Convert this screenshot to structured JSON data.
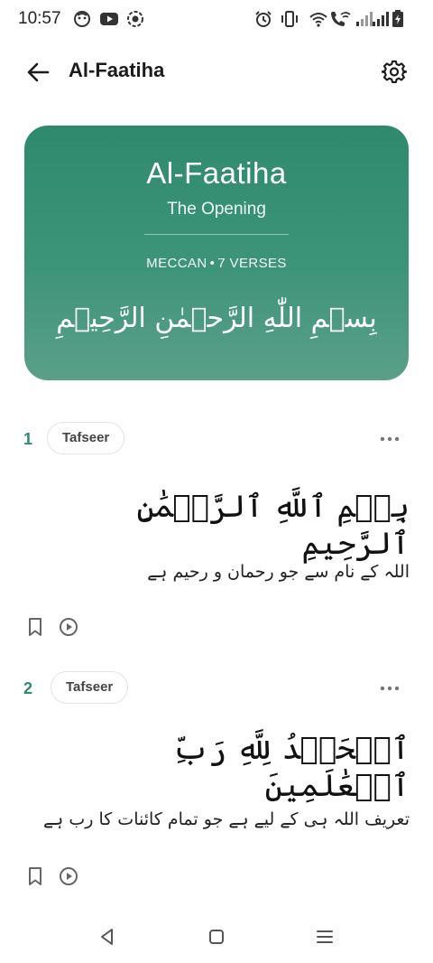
{
  "status_bar": {
    "time": "10:57",
    "icons": [
      "face-icon",
      "youtube-icon",
      "record-icon",
      "alarm-icon",
      "vibrate-icon",
      "wifi-icon",
      "wifi-calling-icon",
      "signal-icon",
      "signal-icon",
      "battery-charging-icon"
    ]
  },
  "app_bar": {
    "title": "Al-Faatiha",
    "back_icon": "arrow-left-icon",
    "settings_icon": "gear-icon"
  },
  "surah_card": {
    "title": "Al-Faatiha",
    "subtitle": "The Opening",
    "revelation": "MECCAN",
    "separator": "•",
    "verses_label": "7 VERSES",
    "bismillah": "بِسۡمِ اللّٰهِ الرَّحۡمٰنِ الرَّحِیۡمِ",
    "gradient_top": "#2f8a6d",
    "gradient_bottom": "#5b9f89"
  },
  "verses": [
    {
      "number": "1",
      "tafseer_label": "Tafseer",
      "arabic": "بِسۡمِ ٱللَّهِ ٱلرَّحۡمَٰنِ ٱلرَّحِيمِ",
      "translation": "اللہ کے نام سے جو رحمان و رحیم ہے"
    },
    {
      "number": "2",
      "tafseer_label": "Tafseer",
      "arabic": "ٱلۡحَمۡدُ لِلَّهِ رَبِّ ٱلۡعَٰلَمِينَ",
      "translation": "تعریف اللہ ہی کے لیے ہے جو تمام کائنات کا رب ہے"
    }
  ],
  "colors": {
    "accent": "#2e8a68",
    "chip_border": "#e3e3e3",
    "icon_gray": "#666666"
  },
  "nav_bar": {
    "icons": [
      "back-triangle-icon",
      "home-square-icon",
      "recents-menu-icon"
    ]
  }
}
